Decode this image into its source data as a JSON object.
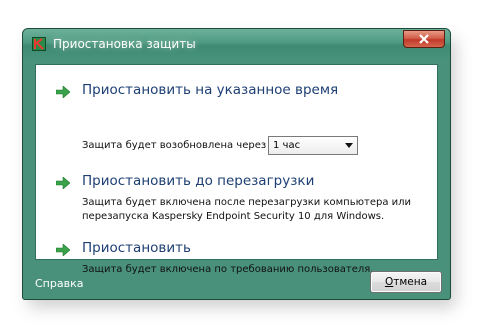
{
  "window": {
    "title": "Приостановка защиты",
    "close_icon": "close-icon"
  },
  "options": [
    {
      "title": "Приостановить на указанное время",
      "description": "Защита будет возобновлена через"
    },
    {
      "title": "Приостановить до перезагрузки",
      "description_line1": "Защита будет включена после перезагрузки компьютера или",
      "description_line2": "перезапуска Kaspersky Endpoint Security 10 для Windows."
    },
    {
      "title": "Приостановить",
      "description": "Защита будет включена по требованию пользователя."
    }
  ],
  "duration_select": {
    "selected": "1 час"
  },
  "footer": {
    "help_label": "Справка",
    "cancel_label_first": "О",
    "cancel_label_rest": "тмена"
  },
  "colors": {
    "window_frame": "#49917b",
    "option_title": "#1d3f73",
    "arrow": "#3aa24a"
  }
}
